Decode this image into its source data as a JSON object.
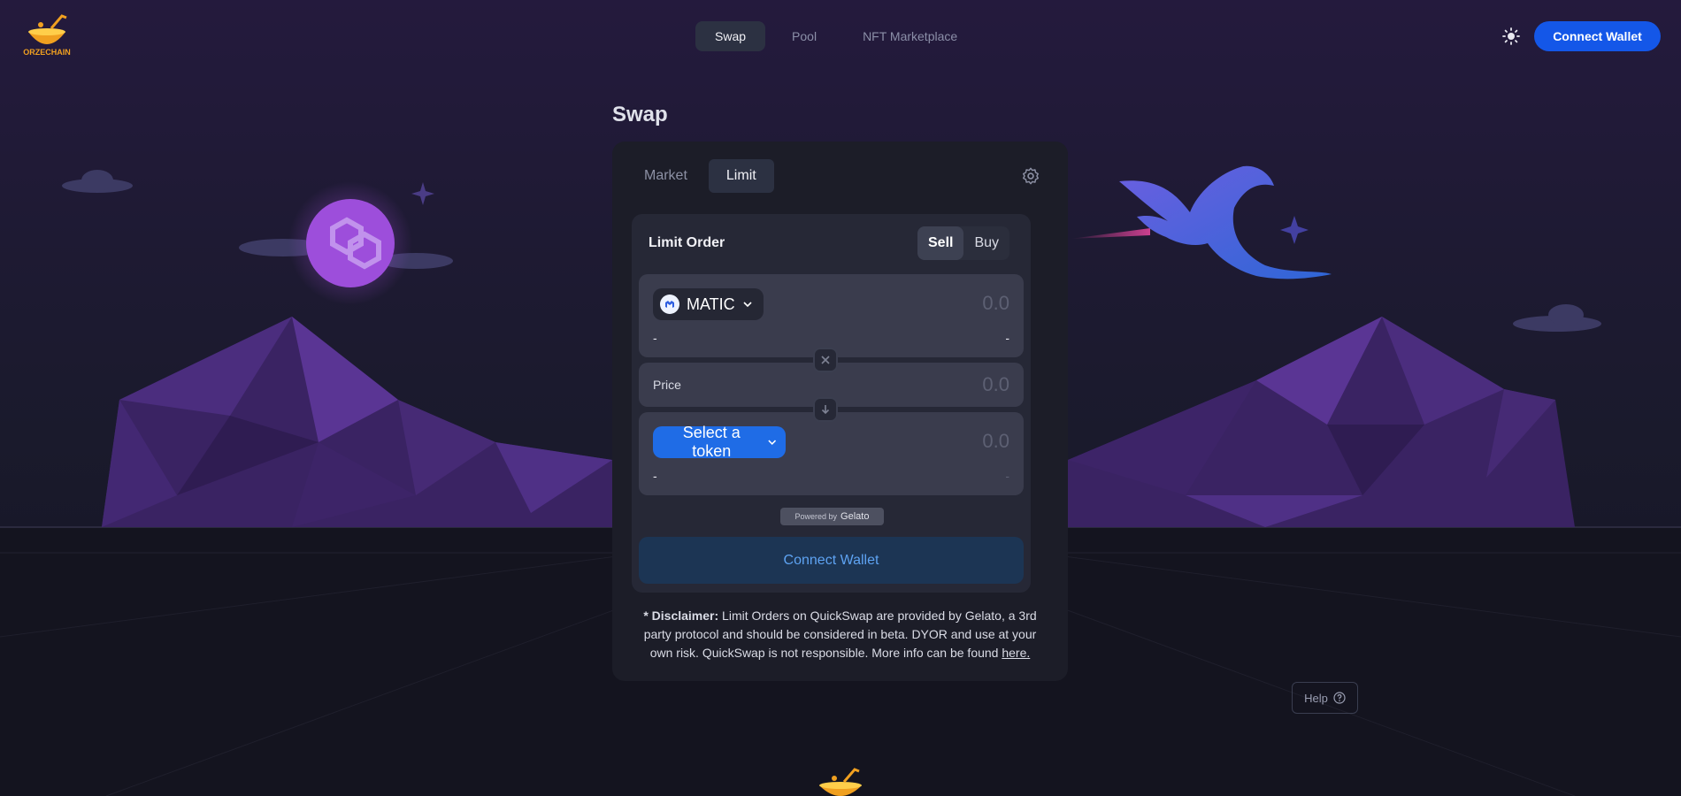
{
  "brand": {
    "name": "ORZECHAIN",
    "accent": "#1457e8"
  },
  "nav": {
    "items": [
      {
        "label": "Swap",
        "active": true
      },
      {
        "label": "Pool",
        "active": false
      },
      {
        "label": "NFT Marketplace",
        "active": false
      }
    ],
    "theme_icon": "sun-icon",
    "connect_label": "Connect Wallet"
  },
  "page_title": "Swap",
  "swap": {
    "tabs": [
      {
        "label": "Market",
        "active": false
      },
      {
        "label": "Limit",
        "active": true
      }
    ],
    "settings_icon": "gear-icon",
    "order": {
      "title": "Limit Order",
      "sides": [
        {
          "label": "Sell",
          "active": true
        },
        {
          "label": "Buy",
          "active": false
        }
      ],
      "sell": {
        "token": "MATIC",
        "amount_placeholder": "0.0",
        "sub_left": "-",
        "sub_right": "-"
      },
      "price": {
        "label": "Price",
        "amount_placeholder": "0.0"
      },
      "buy": {
        "token_label": "Select a token",
        "amount_placeholder": "0.0",
        "sub_left": "-",
        "sub_right": "-"
      },
      "powered_prefix": "Powered by",
      "powered_brand": "Gelato",
      "connect_label": "Connect Wallet"
    },
    "disclaimer": {
      "bold": "* Disclaimer:",
      "text": " Limit Orders on QuickSwap are provided by Gelato, a 3rd party protocol and should be considered in beta. DYOR and use at your own risk. QuickSwap is not responsible. More info can be found ",
      "link": "here."
    }
  },
  "help_label": "Help"
}
